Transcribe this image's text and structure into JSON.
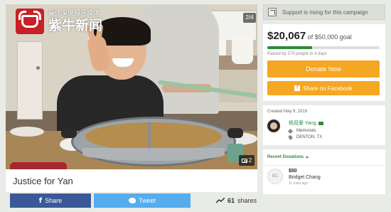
{
  "logo": {
    "subtitle": "最佳深度报道媒体",
    "name": "紫牛新闻"
  },
  "photo": {
    "top_count": "2/4",
    "badge_count": "2"
  },
  "campaign": {
    "title": "Justice for Yan"
  },
  "share": {
    "facebook_label": "Share",
    "twitter_label": "Tweet",
    "shares_count": "61",
    "shares_label": "shares"
  },
  "support_banner": "Support is rising for this campaign",
  "funding": {
    "raised": "$20,067",
    "goal_text": "of $50,000 goal",
    "progress_fraction": 0.4,
    "raised_by": "Raised by 274 people in 4 days"
  },
  "buttons": {
    "donate": "Donate Now",
    "facebook_share": "Share on Facebook"
  },
  "created": "Created May 9, 2019",
  "organizer": {
    "name": "杨双爱 Yang",
    "category": "Memorials",
    "location": "DENTON, TX"
  },
  "recent_donations": {
    "header": "Recent Donations",
    "items": [
      {
        "initials": "BC",
        "amount": "$50",
        "name": "Bridget Chang",
        "time": "11 mins ago"
      }
    ]
  },
  "colors": {
    "progress": "#2d8a3b",
    "donate": "#f5a623",
    "facebook": "#3b5998",
    "twitter": "#55acee"
  }
}
